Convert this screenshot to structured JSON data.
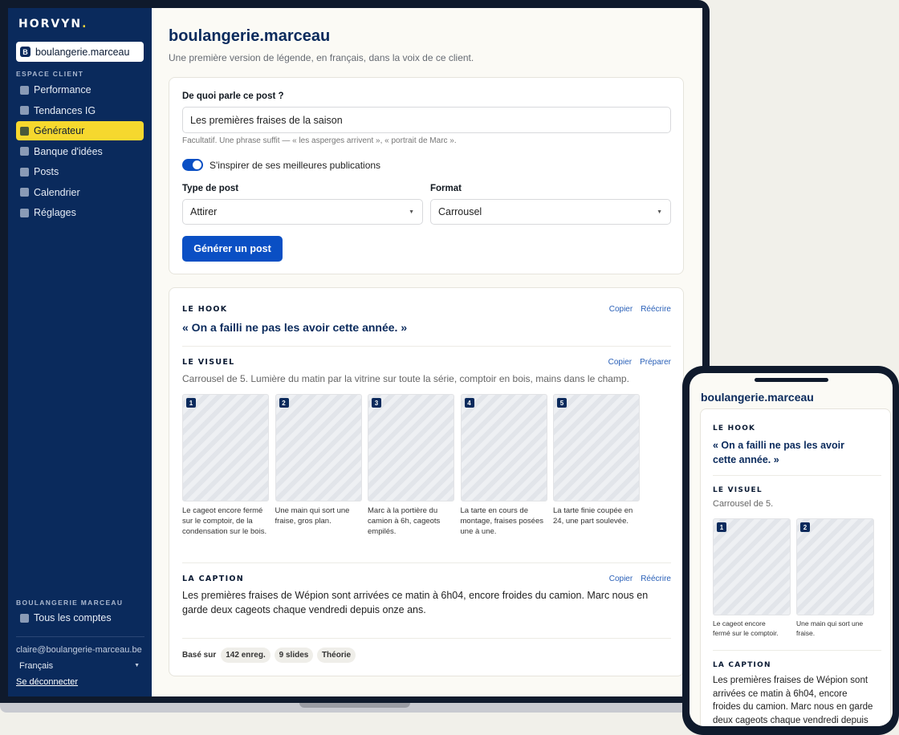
{
  "sidebar": {
    "logo": "HORVYN",
    "logo_dot": ".",
    "account": {
      "badge": "B",
      "name": "boulangerie.marceau"
    },
    "section_client": "ESPACE CLIENT",
    "items": [
      {
        "label": "Performance",
        "active": false
      },
      {
        "label": "Tendances IG",
        "active": false
      },
      {
        "label": "Générateur",
        "active": true
      },
      {
        "label": "Banque d'idées",
        "active": false
      },
      {
        "label": "Posts",
        "active": false
      },
      {
        "label": "Calendrier",
        "active": false
      },
      {
        "label": "Réglages",
        "active": false
      }
    ],
    "section_account": "BOULANGERIE MARCEAU",
    "all_accounts": "Tous les comptes",
    "email": "claire@boulangerie-marceau.be",
    "language": "Français",
    "logout": "Se déconnecter"
  },
  "main": {
    "title": "boulangerie.marceau",
    "subtitle": "Une première version de légende, en français, dans la voix de ce client.",
    "form": {
      "topic_label": "De quoi parle ce post ?",
      "topic_value": "Les premières fraises de la saison",
      "topic_hint": "Facultatif. Une phrase suffit — « les asperges arrivent », « portrait de Marc ».",
      "toggle_label": "S'inspirer de ses meilleures publications",
      "toggle_on": true,
      "type_label": "Type de post",
      "type_value": "Attirer",
      "format_label": "Format",
      "format_value": "Carrousel",
      "generate_button": "Générer un post"
    },
    "result": {
      "hook_title": "LE HOOK",
      "hook_text": "« On a failli ne pas les avoir cette année. »",
      "copy": "Copier",
      "rewrite": "Réécrire",
      "prepare": "Préparer",
      "visual_title": "LE VISUEL",
      "visual_desc": "Carrousel de 5. Lumière du matin par la vitrine sur toute la série, comptoir en bois, mains dans le champ.",
      "slides": [
        {
          "num": "1",
          "caption": "Le cageot encore fermé sur le comptoir, de la condensation sur le bois."
        },
        {
          "num": "2",
          "caption": "Une main qui sort une fraise, gros plan."
        },
        {
          "num": "3",
          "caption": "Marc à la portière du camion à 6h, cageots empilés."
        },
        {
          "num": "4",
          "caption": "La tarte en cours de montage, fraises posées une à une."
        },
        {
          "num": "5",
          "caption": "La tarte finie coupée en 24, une part soulevée."
        }
      ],
      "caption_title": "LA CAPTION",
      "caption_text": "Les premières fraises de Wépion sont arrivées ce matin à 6h04, encore froides du camion. Marc nous en garde deux cageots chaque vendredi depuis onze ans.",
      "based_on": "Basé sur",
      "chips": [
        "142 enreg.",
        "9 slides",
        "Théorie"
      ]
    }
  },
  "phone": {
    "title": "boulangerie.marceau",
    "hook_title": "LE HOOK",
    "hook_text": "« On a failli ne pas les avoir cette année. »",
    "visual_title": "LE VISUEL",
    "visual_desc": "Carrousel de 5.",
    "slides": [
      {
        "num": "1",
        "caption_l1": "Le cageot encore",
        "caption_l2": "fermé sur le comptoir."
      },
      {
        "num": "2",
        "caption_l1": "Une main qui sort une",
        "caption_l2": "fraise."
      }
    ],
    "caption_title": "LA CAPTION",
    "caption_text": "Les premières fraises de Wépion sont arrivées ce matin à 6h04, encore froides du camion. Marc nous en garde deux cageots chaque vendredi depuis onze ans."
  },
  "colors": {
    "navy": "#0a2a5c",
    "accent_yellow": "#f6d82e",
    "primary_blue": "#0a4fc4",
    "background": "#fbfaf5"
  }
}
